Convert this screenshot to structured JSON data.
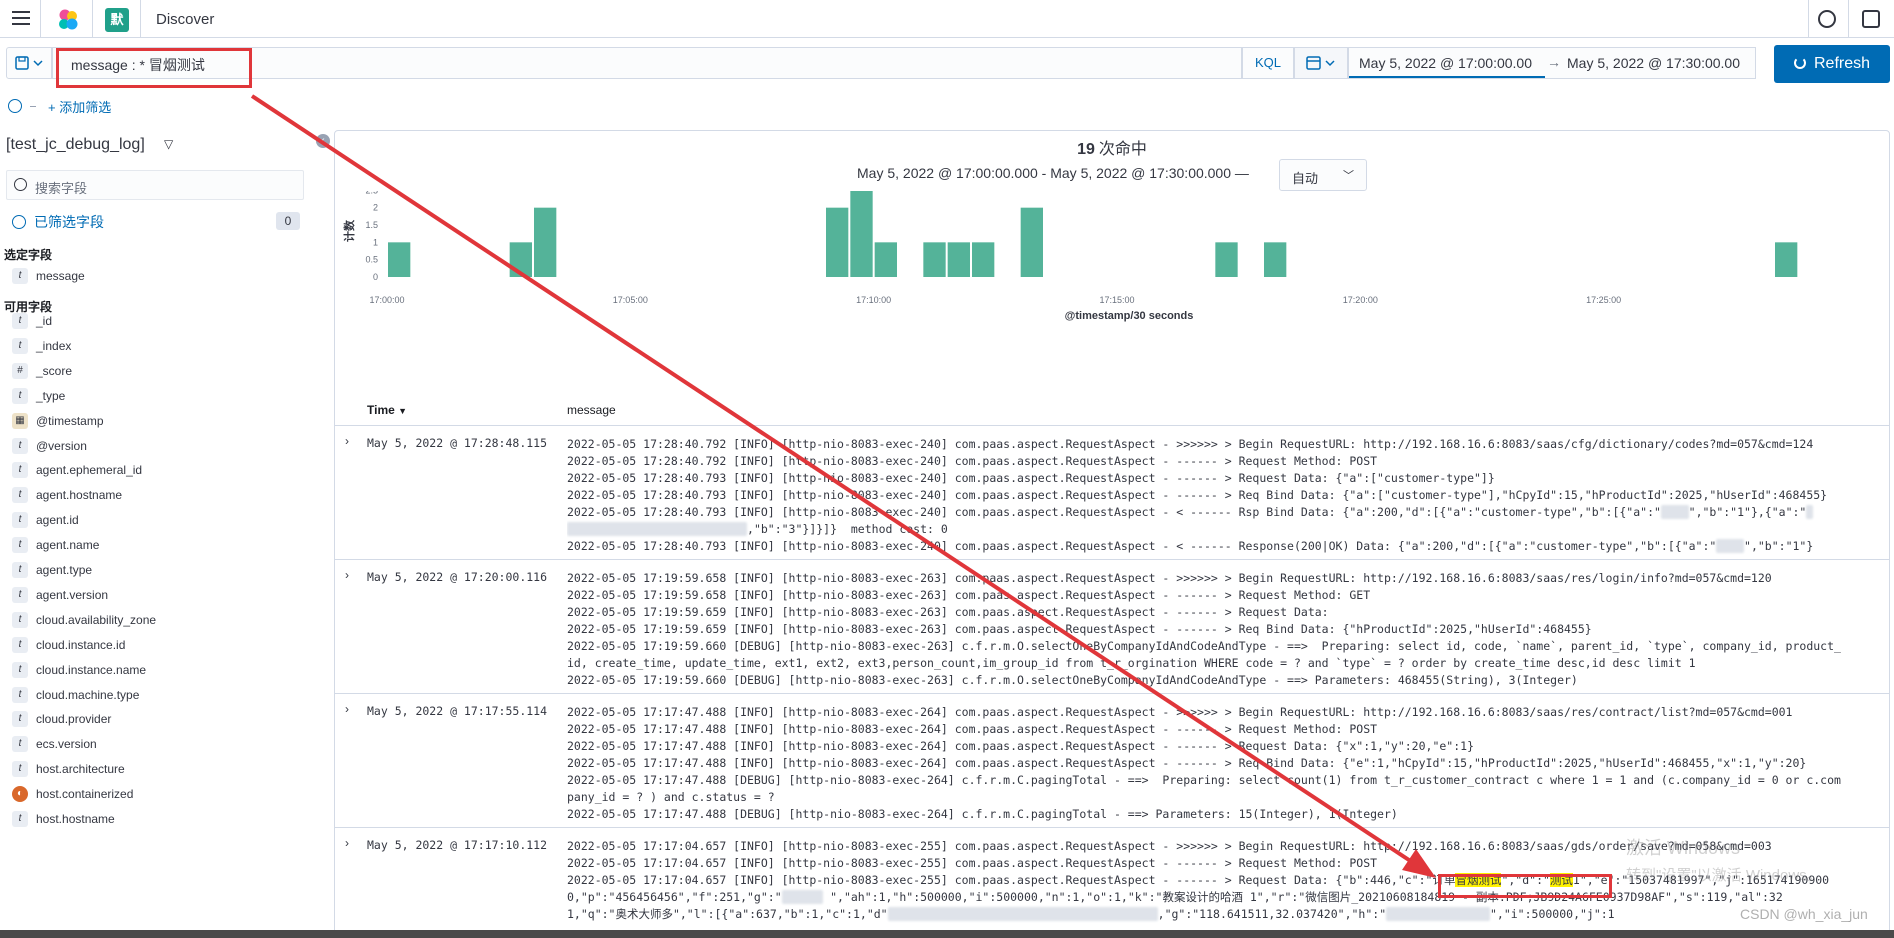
{
  "header": {
    "app_icon_letter": "默",
    "breadcrumb": "Discover"
  },
  "query": {
    "text": "message : * 冒烟测试",
    "language": "KQL"
  },
  "time": {
    "start": "May 5, 2022 @ 17:00:00.00",
    "arrow": "→",
    "end": "May 5, 2022 @ 17:30:00.00",
    "refresh_label": "Refresh"
  },
  "filters": {
    "add_label": "+ 添加筛选"
  },
  "sidebar": {
    "index_pattern": "[test_jc_debug_log]",
    "search_placeholder": "搜索字段",
    "filtered_label": "已筛选字段",
    "filtered_count": "0",
    "selected_header": "选定字段",
    "available_header": "可用字段",
    "selected_fields": [
      {
        "type": "t",
        "name": "message"
      }
    ],
    "available_fields": [
      {
        "type": "t",
        "name": "_id"
      },
      {
        "type": "t",
        "name": "_index"
      },
      {
        "type": "#",
        "name": "_score"
      },
      {
        "type": "t",
        "name": "_type"
      },
      {
        "type": "cal",
        "name": "@timestamp"
      },
      {
        "type": "t",
        "name": "@version"
      },
      {
        "type": "t",
        "name": "agent.ephemeral_id"
      },
      {
        "type": "t",
        "name": "agent.hostname"
      },
      {
        "type": "t",
        "name": "agent.id"
      },
      {
        "type": "t",
        "name": "agent.name"
      },
      {
        "type": "t",
        "name": "agent.type"
      },
      {
        "type": "t",
        "name": "agent.version"
      },
      {
        "type": "t",
        "name": "cloud.availability_zone"
      },
      {
        "type": "t",
        "name": "cloud.instance.id"
      },
      {
        "type": "t",
        "name": "cloud.instance.name"
      },
      {
        "type": "t",
        "name": "cloud.machine.type"
      },
      {
        "type": "t",
        "name": "cloud.provider"
      },
      {
        "type": "t",
        "name": "ecs.version"
      },
      {
        "type": "t",
        "name": "host.architecture"
      },
      {
        "type": "bool",
        "name": "host.containerized"
      },
      {
        "type": "t",
        "name": "host.hostname"
      }
    ]
  },
  "main": {
    "hits_count": "19",
    "hits_label": "次命中",
    "range_text": "May 5, 2022 @ 17:00:00.000 - May 5, 2022 @ 17:30:00.000 —",
    "interval_value": "自动",
    "col_time": "Time",
    "col_message": "message",
    "rows": [
      {
        "time": "May 5, 2022 @ 17:28:48.115",
        "lines": [
          "2022-05-05 17:28:40.792 [INFO] [http-nio-8083-exec-240] com.paas.aspect.RequestAspect - >>>>>> > Begin RequestURL: http://192.168.16.6:8083/saas/cfg/dictionary/codes?md=057&cmd=124",
          "2022-05-05 17:28:40.792 [INFO] [http-nio-8083-exec-240] com.paas.aspect.RequestAspect - ------ > Request Method: POST",
          "2022-05-05 17:28:40.793 [INFO] [http-nio-8083-exec-240] com.paas.aspect.RequestAspect - ------ > Request Data: {\"a\":[\"customer-type\"]}",
          "2022-05-05 17:28:40.793 [INFO] [http-nio-8083-exec-240] com.paas.aspect.RequestAspect - ------ > Req Bind Data: {\"a\":[\"customer-type\"],\"hCpyId\":15,\"hProductId\":2025,\"hUserId\":468455}",
          "2022-05-05 17:28:40.793 [INFO] [http-nio-8083-exec-240] com.paas.aspect.RequestAspect - < ------ Rsp Bind Data: {\"a\":200,\"d\":[{\"a\":\"customer-type\",\"b\":[{\"a\":\"▒▒▒▒\",\"b\":\"1\"},{\"a\":\"▒",
          "▒▒▒▒▒▒▒▒▒▒▒▒▒▒▒▒▒▒▒▒▒▒▒▒▒▒,\"b\":\"3\"}]}]}  method cost: 0",
          "2022-05-05 17:28:40.793 [INFO] [http-nio-8083-exec-240] com.paas.aspect.RequestAspect - < ------ Response(200|OK) Data: {\"a\":200,\"d\":[{\"a\":\"customer-type\",\"b\":[{\"a\":\"▒▒▒▒\",\"b\":\"1\"}"
        ]
      },
      {
        "time": "May 5, 2022 @ 17:20:00.116",
        "lines": [
          "2022-05-05 17:19:59.658 [INFO] [http-nio-8083-exec-263] com.paas.aspect.RequestAspect - >>>>>> > Begin RequestURL: http://192.168.16.6:8083/saas/res/login/info?md=057&cmd=120",
          "2022-05-05 17:19:59.658 [INFO] [http-nio-8083-exec-263] com.paas.aspect.RequestAspect - ------ > Request Method: GET",
          "2022-05-05 17:19:59.659 [INFO] [http-nio-8083-exec-263] com.paas.aspect.RequestAspect - ------ > Request Data:",
          "2022-05-05 17:19:59.659 [INFO] [http-nio-8083-exec-263] com.paas.aspect.RequestAspect - ------ > Req Bind Data: {\"hProductId\":2025,\"hUserId\":468455}",
          "2022-05-05 17:19:59.660 [DEBUG] [http-nio-8083-exec-263] c.f.r.m.O.selectOneByCompanyIdAndCodeAndType - ==>  Preparing: select id, code, `name`, parent_id, `type`, company_id, product_",
          "id, create_time, update_time, ext1, ext2, ext3,person_count,im_group_id from t_r_orgination WHERE code = ? and `type` = ? order by create_time desc,id desc limit 1",
          "2022-05-05 17:19:59.660 [DEBUG] [http-nio-8083-exec-263] c.f.r.m.O.selectOneByCompanyIdAndCodeAndType - ==> Parameters: 468455(String), 3(Integer)"
        ]
      },
      {
        "time": "May 5, 2022 @ 17:17:55.114",
        "lines": [
          "2022-05-05 17:17:47.488 [INFO] [http-nio-8083-exec-264] com.paas.aspect.RequestAspect - >>>>>> > Begin RequestURL: http://192.168.16.6:8083/saas/res/contract/list?md=057&cmd=001",
          "2022-05-05 17:17:47.488 [INFO] [http-nio-8083-exec-264] com.paas.aspect.RequestAspect - ------ > Request Method: POST",
          "2022-05-05 17:17:47.488 [INFO] [http-nio-8083-exec-264] com.paas.aspect.RequestAspect - ------ > Request Data: {\"x\":1,\"y\":20,\"e\":1}",
          "2022-05-05 17:17:47.488 [INFO] [http-nio-8083-exec-264] com.paas.aspect.RequestAspect - ------ > Req Bind Data: {\"e\":1,\"hCpyId\":15,\"hProductId\":2025,\"hUserId\":468455,\"x\":1,\"y\":20}",
          "2022-05-05 17:17:47.488 [DEBUG] [http-nio-8083-exec-264] c.f.r.m.C.pagingTotal - ==>  Preparing: select count(1) from t_r_customer_contract c where 1 = 1 and (c.company_id = 0 or c.com",
          "pany_id = ? ) and c.status = ?",
          "2022-05-05 17:17:47.488 [DEBUG] [http-nio-8083-exec-264] c.f.r.m.C.pagingTotal - ==> Parameters: 15(Integer), 1(Integer)"
        ]
      },
      {
        "time": "May 5, 2022 @ 17:17:10.112",
        "lines": [
          "2022-05-05 17:17:04.657 [INFO] [http-nio-8083-exec-255] com.paas.aspect.RequestAspect - >>>>>> > Begin RequestURL: http://192.168.16.6:8083/saas/gds/order/save?md=058&cmd=003",
          "2022-05-05 17:17:04.657 [INFO] [http-nio-8083-exec-255] com.paas.aspect.RequestAspect - ------ > Request Method: POST",
          "2022-05-05 17:17:04.657 [INFO] [http-nio-8083-exec-255] com.paas.aspect.RequestAspect - ------ > Request Data: {\"b\":446,\"c\":\"订单冒烟测试\",\"d\":\"测试1\",\"e\":\"15037481997\",\"j\":165174190900",
          "0,\"p\":\"456456456\",\"f\":251,\"g\":\"▒▒▒▒▒▒ \",\"ah\":1,\"h\":500000,\"i\":500000,\"n\":1,\"o\":1,\"k\":\"教案设计的哈酒 1\",\"r\":\"微信图片_20210608184819 - 副本.PDF;JB9D24A6FE0937D98AF\",\"s\":119,\"al\":32",
          "1,\"q\":\"奥术大师多\",\"l\":[{\"a\":637,\"b\":1,\"c\":1,\"d\"▒▒▒▒▒▒▒▒▒▒▒▒▒▒▒▒▒▒▒▒▒▒▒▒▒▒▒▒▒▒▒▒▒▒▒▒▒▒▒,\"g\":\"118.641511,32.037420\",\"h\":\"▒▒▒▒▒▒▒▒▒▒▒▒▒▒▒\",\"i\":500000,\"j\":1"
        ]
      }
    ]
  },
  "chart_data": {
    "type": "bar",
    "xlabel": "@timestamp/30 seconds",
    "ylabel": "计数",
    "ylim": [
      0,
      3
    ],
    "yticks": [
      "0",
      "0.5",
      "1",
      "1.5",
      "2",
      "2.5",
      "3"
    ],
    "xticks": [
      "17:00:00",
      "17:05:00",
      "17:10:00",
      "17:15:00",
      "17:20:00",
      "17:25:00"
    ],
    "x_bucket_index": [
      0,
      5,
      6,
      18,
      19,
      20,
      22,
      23,
      24,
      26,
      34,
      36,
      57
    ],
    "values": [
      1,
      1,
      2,
      2,
      3,
      1,
      1,
      1,
      1,
      2,
      1,
      1,
      1
    ],
    "bar_color": "#54b399",
    "grid": false
  },
  "colors": {
    "accent": "#006bb4",
    "annotation": "#e0363a",
    "highlight": "#fff200"
  },
  "watermark": {
    "line1": "激活 Windows",
    "line2": "转到\"设置\"以激活 Windows。",
    "csdn": "CSDN @wh_xia_jun"
  }
}
